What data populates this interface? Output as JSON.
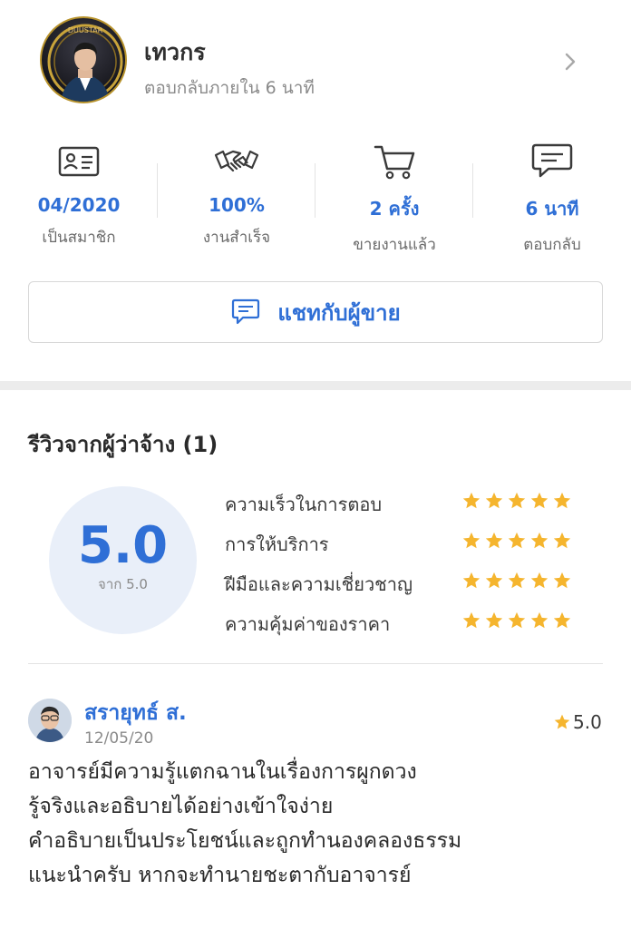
{
  "seller": {
    "name": "เทวกร",
    "response_note": "ตอบกลับภายใน 6 นาที",
    "avatar_badge_text": "DUUSTAR"
  },
  "stats": [
    {
      "icon": "id-card-icon",
      "value": "04/2020",
      "label": "เป็นสมาชิก"
    },
    {
      "icon": "handshake-icon",
      "value": "100%",
      "label": "งานสำเร็จ"
    },
    {
      "icon": "shopping-cart-icon",
      "value": "2 ครั้ง",
      "label": "ขายงานแล้ว"
    },
    {
      "icon": "chat-bubble-icon",
      "value": "6 นาที",
      "label": "ตอบกลับ"
    }
  ],
  "chat_button": {
    "label": "แชทกับผู้ขาย",
    "icon": "chat-bubble-icon"
  },
  "reviews": {
    "title": "รีวิวจากผู้ว่าจ้าง (1)",
    "overall_score": "5.0",
    "overall_out_of": "จาก 5.0",
    "criteria": [
      {
        "label": "ความเร็วในการตอบ",
        "stars": 5
      },
      {
        "label": "การให้บริการ",
        "stars": 5
      },
      {
        "label": "ฝีมือและความเชี่ยวชาญ",
        "stars": 5
      },
      {
        "label": "ความคุ้มค่าของราคา",
        "stars": 5
      }
    ],
    "items": [
      {
        "reviewer": "สรายุทธ์ ส.",
        "date": "12/05/20",
        "score": "5.0",
        "text": [
          "อาจารย์มีความรู้แตกฉานในเรื่องการผูกดวง",
          "รู้จริงและอธิบายได้อย่างเข้าใจง่าย",
          "คำอธิบายเป็นประโยชน์และถูกทำนองคลองธรรม",
          "แนะนำครับ หากจะทำนายชะตากับอาจารย์"
        ]
      }
    ]
  },
  "colors": {
    "accent": "#2f6fd6",
    "star": "#f5b52e",
    "score_bg": "#e9eff9"
  }
}
